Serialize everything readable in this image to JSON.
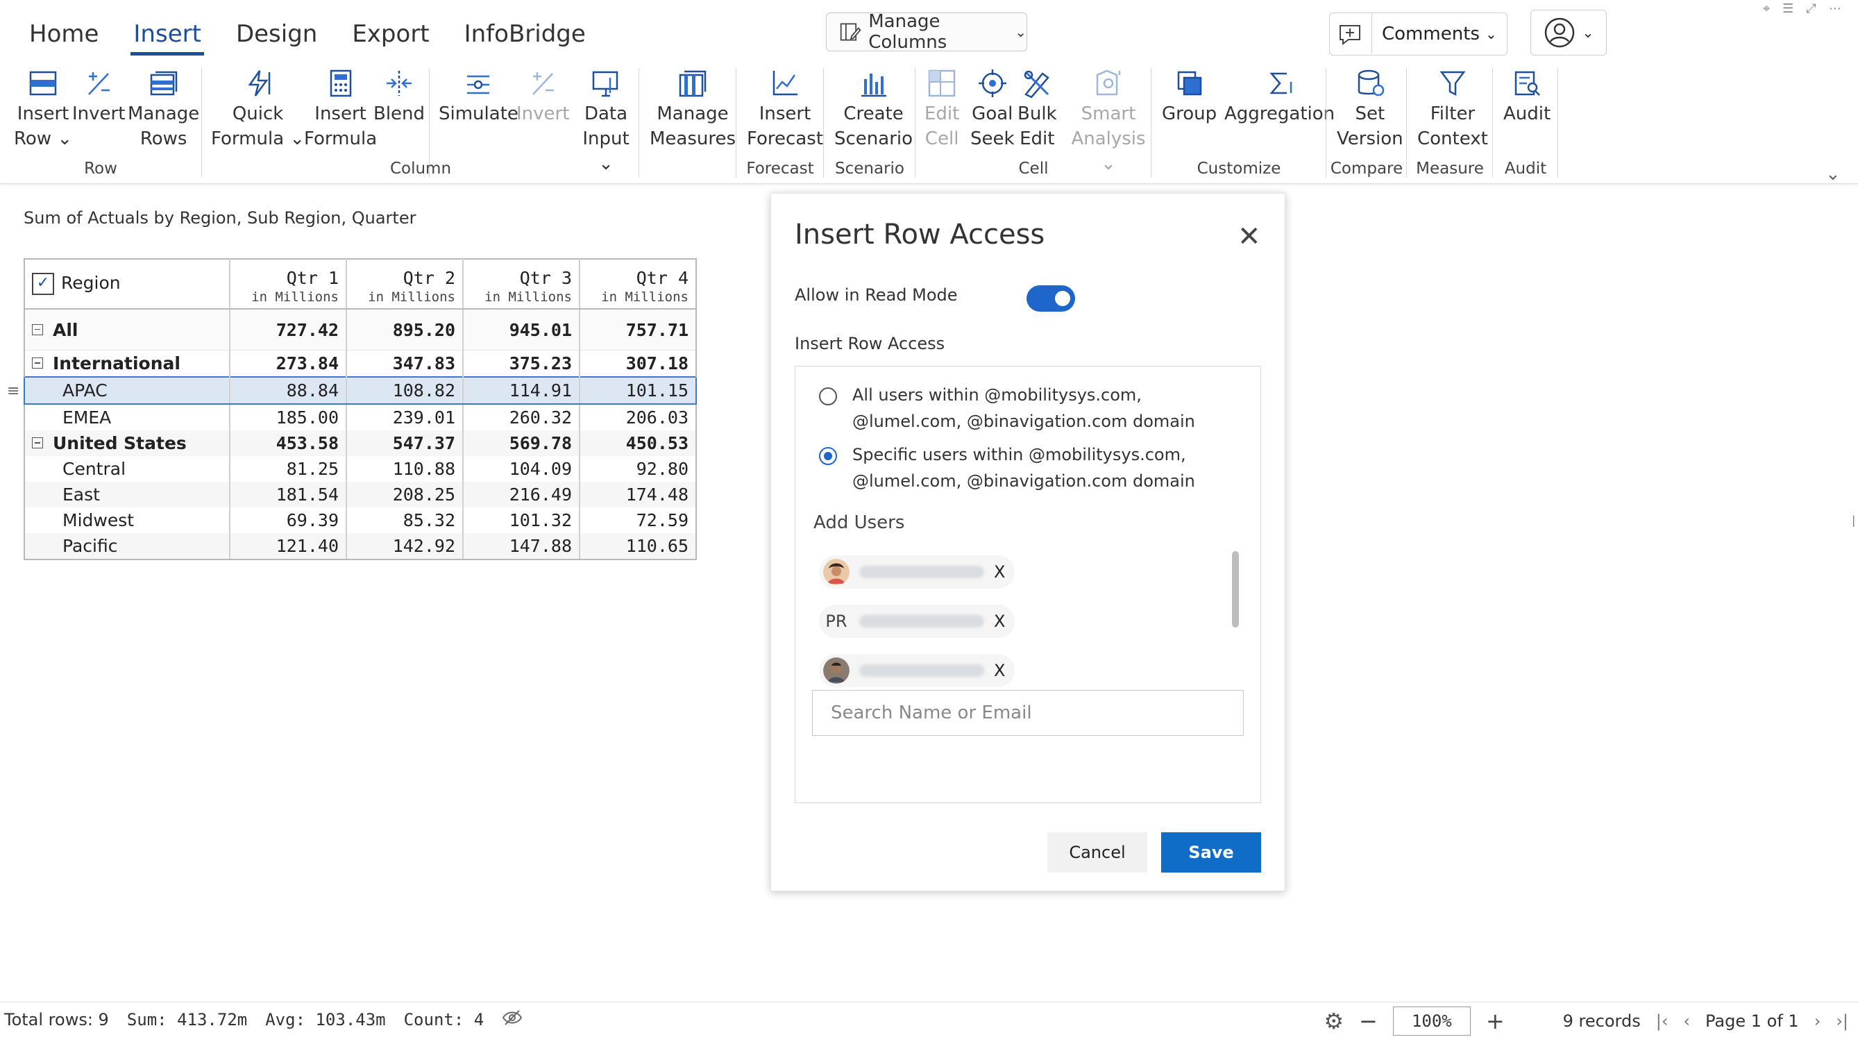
{
  "ribbon": {
    "tabs": [
      {
        "label": "Home"
      },
      {
        "label": "Insert",
        "active": true
      },
      {
        "label": "Design"
      },
      {
        "label": "Export"
      },
      {
        "label": "InfoBridge"
      }
    ],
    "manage_columns": "Manage Columns",
    "comments": "Comments",
    "groups": {
      "row": "Row",
      "column": "Column",
      "forecast": "Forecast",
      "scenario": "Scenario",
      "cell": "Cell",
      "customize": "Customize",
      "compare": "Compare",
      "measure": "Measure",
      "audit": "Audit"
    },
    "buttons": {
      "insert_row_1": "Insert",
      "insert_row_2": "Row",
      "invert": "Invert",
      "manage_rows_1": "Manage",
      "manage_rows_2": "Rows",
      "quick_formula_1": "Quick",
      "quick_formula_2": "Formula",
      "insert_formula_1": "Insert",
      "insert_formula_2": "Formula",
      "blend": "Blend",
      "simulate": "Simulate",
      "invert_col": "Invert",
      "data_input_1": "Data",
      "data_input_2": "Input",
      "manage_measures_1": "Manage",
      "manage_measures_2": "Measures",
      "insert_forecast_1": "Insert",
      "insert_forecast_2": "Forecast",
      "create_scenario_1": "Create",
      "create_scenario_2": "Scenario",
      "edit_cell_1": "Edit",
      "edit_cell_2": "Cell",
      "goal_seek_1": "Goal",
      "goal_seek_2": "Seek",
      "bulk_edit_1": "Bulk",
      "bulk_edit_2": "Edit",
      "smart_analysis_1": "Smart",
      "smart_analysis_2": "Analysis",
      "group": "Group",
      "aggregation": "Aggregation",
      "set_version_1": "Set",
      "set_version_2": "Version",
      "filter_context_1": "Filter",
      "filter_context_2": "Context",
      "audit": "Audit"
    }
  },
  "report": {
    "subtitle": "Sum of Actuals by Region, Sub Region, Quarter",
    "region_header": "Region",
    "unit": "in Millions",
    "quarters": [
      "Qtr 1",
      "Qtr 2",
      "Qtr 3",
      "Qtr 4"
    ],
    "rows": [
      {
        "label": "All",
        "values": [
          "727.42",
          "895.20",
          "945.01",
          "757.71"
        ]
      },
      {
        "label": "International",
        "values": [
          "273.84",
          "347.83",
          "375.23",
          "307.18"
        ]
      },
      {
        "label": "APAC",
        "values": [
          "88.84",
          "108.82",
          "114.91",
          "101.15"
        ]
      },
      {
        "label": "EMEA",
        "values": [
          "185.00",
          "239.01",
          "260.32",
          "206.03"
        ]
      },
      {
        "label": "United States",
        "values": [
          "453.58",
          "547.37",
          "569.78",
          "450.53"
        ]
      },
      {
        "label": "Central",
        "values": [
          "81.25",
          "110.88",
          "104.09",
          "92.80"
        ]
      },
      {
        "label": "East",
        "values": [
          "181.54",
          "208.25",
          "216.49",
          "174.48"
        ]
      },
      {
        "label": "Midwest",
        "values": [
          "69.39",
          "85.32",
          "101.32",
          "72.59"
        ]
      },
      {
        "label": "Pacific",
        "values": [
          "121.40",
          "142.92",
          "147.88",
          "110.65"
        ]
      }
    ]
  },
  "dialog": {
    "title": "Insert Row Access",
    "allow_read_mode": "Allow in Read Mode",
    "allow_read_mode_on": true,
    "section_label": "Insert Row Access",
    "option_all": "All users within @mobilitysys.com, @lumel.com, @binavigation.com domain",
    "option_specific": "Specific users within @mobilitysys.com, @lumel.com, @binavigation.com domain",
    "selected_option": "specific",
    "add_users_label": "Add Users",
    "users": [
      {
        "initials": "",
        "remove": "X"
      },
      {
        "initials": "PR",
        "remove": "X"
      },
      {
        "initials": "",
        "remove": "X"
      }
    ],
    "search_placeholder": "Search Name or Email",
    "cancel": "Cancel",
    "save": "Save"
  },
  "status": {
    "total_rows": "Total rows: 9",
    "sum": "Sum: 413.72m",
    "avg": "Avg: 103.43m",
    "count": "Count: 4",
    "zoom": "100%",
    "records": "9 records",
    "page": "Page 1 of 1"
  },
  "colors": {
    "accent": "#1f4e9c",
    "primary_button": "#0f6cc7",
    "selection": "#dde6f3",
    "toggle": "#1e66c9"
  }
}
